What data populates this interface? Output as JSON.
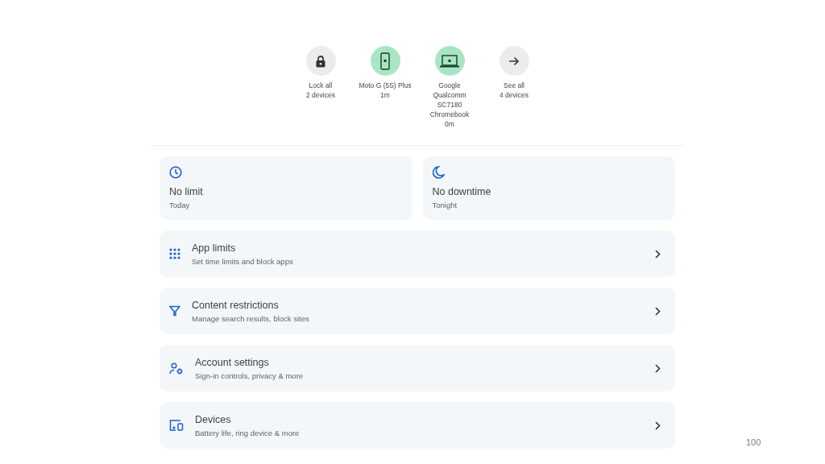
{
  "devices": [
    {
      "kind": "lock",
      "label": "Lock all",
      "detail": "2 devices"
    },
    {
      "kind": "phone",
      "label": "Moto G (5S) Plus",
      "detail": "1m"
    },
    {
      "kind": "laptop",
      "label": "Google Qualcomm SC7180 Chromebook",
      "detail": "0m"
    },
    {
      "kind": "arrow",
      "label": "See all",
      "detail": "4 devices"
    }
  ],
  "summary": [
    {
      "kind": "clock",
      "title": "No limit",
      "subtitle": "Today"
    },
    {
      "kind": "moon",
      "title": "No downtime",
      "subtitle": "Tonight"
    }
  ],
  "settings": [
    {
      "kind": "apps",
      "title": "App limits",
      "subtitle": "Set time limits and block apps"
    },
    {
      "kind": "filter",
      "title": "Content restrictions",
      "subtitle": "Manage search results, block sites"
    },
    {
      "kind": "account",
      "title": "Account settings",
      "subtitle": "Sign-in controls, privacy & more"
    },
    {
      "kind": "devices",
      "title": "Devices",
      "subtitle": "Battery life, ring device & more"
    }
  ],
  "page_number": "100"
}
